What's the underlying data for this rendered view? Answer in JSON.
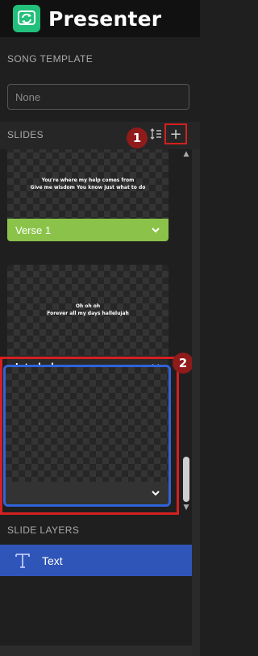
{
  "app": {
    "title": "Presenter",
    "logo_icon": "presenter-logo-icon",
    "accent": "#22c07a"
  },
  "song_template": {
    "label": "SONG TEMPLATE",
    "value": "None"
  },
  "slides": {
    "label": "SLIDES",
    "add_label": "+",
    "items": [
      {
        "text": "You're where my help comes from\nGive me wisdom You know just what to do",
        "label": "Verse 1",
        "footer_color": "#8bc34a"
      },
      {
        "text": "Oh oh oh\nForever all my days hallelujah",
        "label": "Interlude a",
        "footer_color": "#2a2a2a"
      },
      {
        "text": "",
        "label": "",
        "footer_color": "#333333",
        "selected": true
      }
    ]
  },
  "callouts": {
    "one": "1",
    "two": "2",
    "color": "#8f1b1b"
  },
  "slide_layers": {
    "label": "SLIDE LAYERS",
    "items": [
      {
        "label": "Text",
        "icon": "text-layer-icon"
      }
    ]
  }
}
